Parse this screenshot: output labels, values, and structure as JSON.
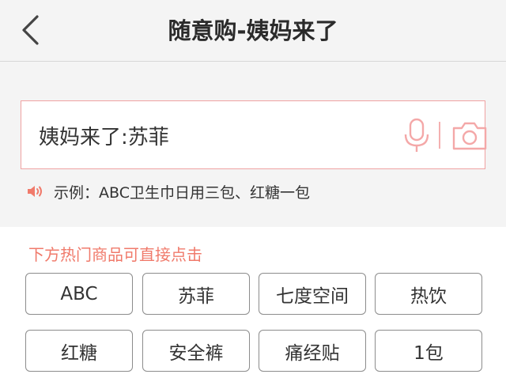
{
  "header": {
    "title": "随意购-姨妈来了",
    "back_icon": "chevron-left-icon"
  },
  "search": {
    "value": "姨妈来了:苏菲",
    "mic_icon": "microphone-icon",
    "camera_icon": "camera-icon"
  },
  "example": {
    "icon": "speaker-icon",
    "text": "示例：ABC卫生巾日用三包、红糖一包"
  },
  "hot": {
    "hint": "下方热门商品可直接点击",
    "tags": [
      "ABC",
      "苏菲",
      "七度空间",
      "热饮",
      "红糖",
      "安全裤",
      "痛经贴",
      "1包"
    ]
  },
  "colors": {
    "accent": "#f07a6b",
    "border_accent": "#f0a2a2",
    "background": "#f4f4f4"
  }
}
